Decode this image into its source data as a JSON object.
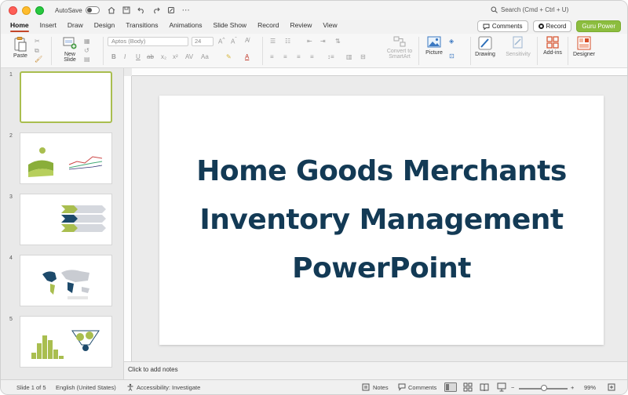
{
  "titlebar": {
    "autosave_label": "AutoSave",
    "search_text": "Search (Cmd + Ctrl + U)"
  },
  "tabs": [
    "Home",
    "Insert",
    "Draw",
    "Design",
    "Transitions",
    "Animations",
    "Slide Show",
    "Record",
    "Review",
    "View"
  ],
  "tab_actions": {
    "comments": "Comments",
    "record": "Record",
    "guru": "Guru Power"
  },
  "ribbon": {
    "paste": "Paste",
    "new_slide_1": "New",
    "new_slide_2": "Slide",
    "font_name": "Aptos (Body)",
    "font_size": "24",
    "convert_1": "Convert to",
    "convert_2": "SmartArt",
    "picture": "Picture",
    "drawing": "Drawing",
    "sensitivity": "Sensitivity",
    "addins": "Add-ins",
    "designer": "Designer"
  },
  "thumbnails": [
    "1",
    "2",
    "3",
    "4",
    "5"
  ],
  "slide": {
    "line1": "Home Goods Merchants",
    "line2": "Inventory Management",
    "line3": "PowerPoint"
  },
  "notes_placeholder": "Click to add notes",
  "status": {
    "slide_of": "Slide 1 of 5",
    "language": "English (United States)",
    "accessibility": "Accessibility: Investigate",
    "notes": "Notes",
    "comments": "Comments",
    "zoom": "99%"
  },
  "colors": {
    "accent_tab": "#c4462a",
    "title_color": "#133a55",
    "thumb_green": "#a9be4f",
    "guru_green": "#8cbd3f"
  }
}
